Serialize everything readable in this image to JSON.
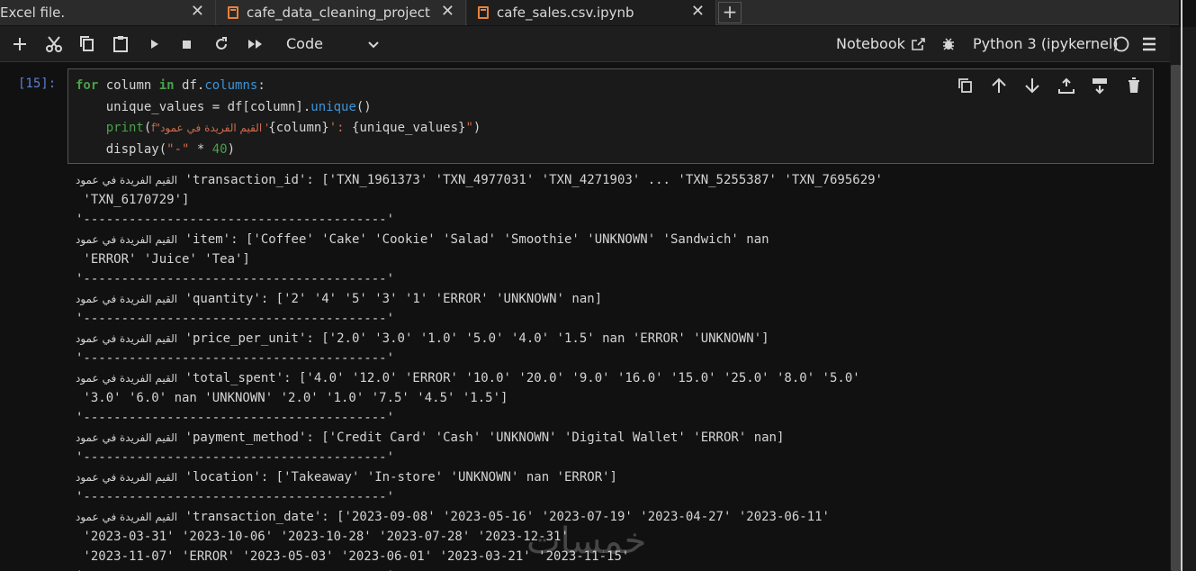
{
  "tabs": [
    {
      "label": "Excel file.",
      "active": false
    },
    {
      "label": "cafe_data_cleaning_project",
      "active": false
    },
    {
      "label": "cafe_sales.csv.ipynb",
      "active": true
    }
  ],
  "tab_close": "✕",
  "tab_add": "+",
  "toolbar": {
    "cell_type": "Code",
    "notebook_label": "Notebook",
    "kernel_label": "Python 3 (ipykernel)"
  },
  "cell": {
    "prompt": "[15]:",
    "code": {
      "l1_for": "for",
      "l1_var": " column ",
      "l1_in": "in",
      "l1_df": " df.",
      "l1_attr": "columns",
      "l1_colon": ":",
      "l2_a": "    unique_values = df[column].",
      "l2_fn": "unique",
      "l2_b": "()",
      "l3_indent": "    ",
      "l3_print": "print",
      "l3_open": "(",
      "l3_str1": "f\"القيم الفريدة في عمود '",
      "l3_expr1": "{column}",
      "l3_str2": "': ",
      "l3_expr2": "{unique_values}",
      "l3_str3": "\"",
      "l3_close": ")",
      "l4_a": "    display(",
      "l4_str": "\"-\"",
      "l4_op": " * ",
      "l4_num": "40",
      "l4_close": ")"
    }
  },
  "output": {
    "prefix": "القيم الفريدة في عمود",
    "separator": "'----------------------------------------'",
    "blocks": [
      {
        "first": " 'transaction_id': ['TXN_1961373' 'TXN_4977031' 'TXN_4271903' ... 'TXN_5255387' 'TXN_7695629'",
        "more": [
          " 'TXN_6170729']"
        ]
      },
      {
        "first": " 'item': ['Coffee' 'Cake' 'Cookie' 'Salad' 'Smoothie' 'UNKNOWN' 'Sandwich' nan",
        "more": [
          " 'ERROR' 'Juice' 'Tea']"
        ]
      },
      {
        "first": " 'quantity': ['2' '4' '5' '3' '1' 'ERROR' 'UNKNOWN' nan]",
        "more": []
      },
      {
        "first": " 'price_per_unit': ['2.0' '3.0' '1.0' '5.0' '4.0' '1.5' nan 'ERROR' 'UNKNOWN']",
        "more": []
      },
      {
        "first": " 'total_spent': ['4.0' '12.0' 'ERROR' '10.0' '20.0' '9.0' '16.0' '15.0' '25.0' '8.0' '5.0'",
        "more": [
          " '3.0' '6.0' nan 'UNKNOWN' '2.0' '1.0' '7.5' '4.5' '1.5']"
        ]
      },
      {
        "first": " 'payment_method': ['Credit Card' 'Cash' 'UNKNOWN' 'Digital Wallet' 'ERROR' nan]",
        "more": []
      },
      {
        "first": " 'location': ['Takeaway' 'In-store' 'UNKNOWN' nan 'ERROR']",
        "more": []
      },
      {
        "first": " 'transaction_date': ['2023-09-08' '2023-05-16' '2023-07-19' '2023-04-27' '2023-06-11'",
        "more": [
          " '2023-03-31' '2023-10-06' '2023-10-28' '2023-07-28' '2023-12-31'",
          " '2023-11-07' 'ERROR' '2023-05-03' '2023-06-01' '2023-03-21' '2023-11-15'"
        ]
      }
    ]
  },
  "watermark": "خمسات",
  "colors": {
    "accent_tab_icon": "#e8823a",
    "keyword": "#4aa04a",
    "string": "#ce6b4b",
    "prompt": "#5c7fd6"
  }
}
